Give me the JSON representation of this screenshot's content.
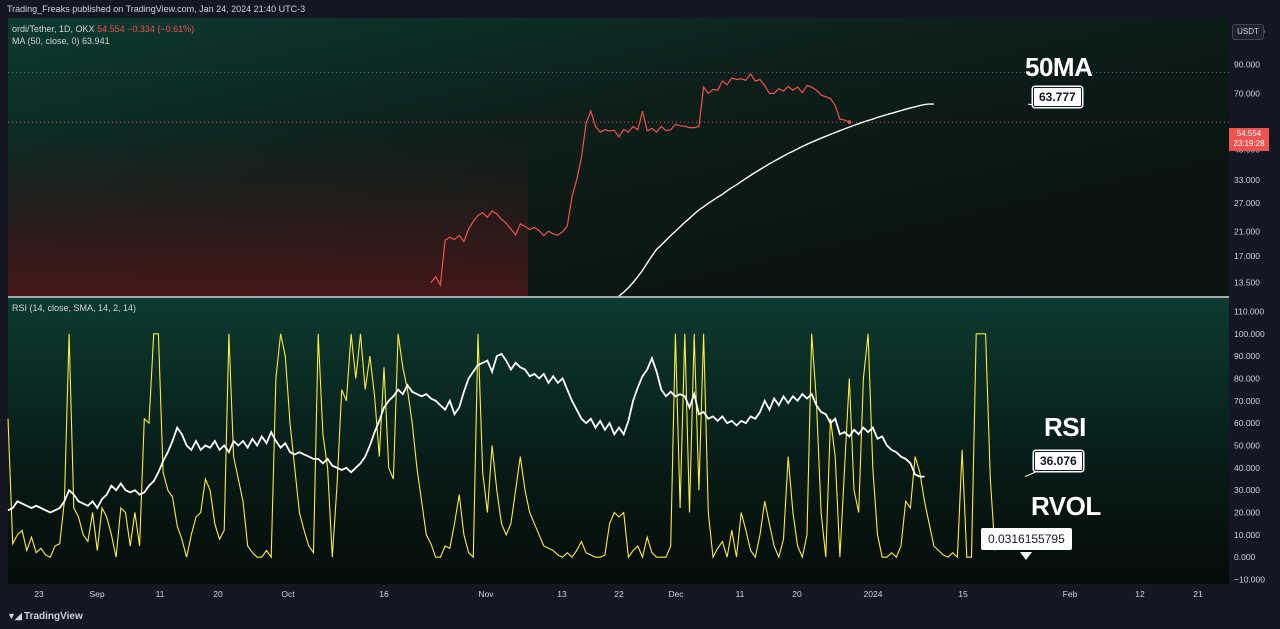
{
  "header": {
    "published": "Trading_Freaks published on TradingView.com, Jan 24, 2024 21:40 UTC-3"
  },
  "legend": {
    "symbol": "ordi/Tether, 1D, OKX",
    "price": "54.554",
    "change": "−0.334 (−0.61%)",
    "ma_label": "MA (50, close, 0)",
    "ma_value": "63.941",
    "rsi_label": "RSI (14, close, SMA, 14, 2, 14)"
  },
  "currency_button": "USDT",
  "price_tag": {
    "price": "54.554",
    "countdown": "23:19:28"
  },
  "annotations": {
    "ma_title": "50MA",
    "ma_callout": "63.777",
    "rsi_title": "RSI",
    "rsi_callout": "36.076",
    "rvol_title": "RVOL",
    "rvol_tooltip": "0.0316155795"
  },
  "footer": {
    "brand": "TradingView"
  },
  "colors": {
    "price": "#ef5350",
    "ma": "#ffffff",
    "rsi": "#ffffff",
    "rvol": "#ffeb3b",
    "background": "#131722"
  },
  "chart_data": [
    {
      "type": "line",
      "pane": "price",
      "scale": "log",
      "x_ticks": [
        "23",
        "Sep",
        "11",
        "20",
        "Oct",
        "16",
        "Nov",
        "13",
        "22",
        "Dec",
        "11",
        "20",
        "2024",
        "15",
        "Feb",
        "12",
        "21"
      ],
      "y_ticks": [
        120,
        90,
        70,
        54.554,
        43,
        33,
        27,
        21,
        17,
        13.5
      ],
      "y_tick_labels": [
        "120.000",
        "90.000",
        "70.000",
        "54.554",
        "43.000",
        "33.000",
        "27.000",
        "21.000",
        "17.000",
        "13.500"
      ],
      "ylim": [
        12.0,
        135
      ],
      "series": [
        {
          "name": "ordi/Tether",
          "start_day": 90,
          "values": [
            13.5,
            14.2,
            13.2,
            19.5,
            20.0,
            19.6,
            20.3,
            19.3,
            21.5,
            23.0,
            24.2,
            24.8,
            23.8,
            25.2,
            24.5,
            23.4,
            22.6,
            21.5,
            20.4,
            22.5,
            22.0,
            21.4,
            21.8,
            21.2,
            20.3,
            21.1,
            20.6,
            20.4,
            21.0,
            22.1,
            28.5,
            33.0,
            40.0,
            54.0,
            60.0,
            52.5,
            50.0,
            51.0,
            50.5,
            50.8,
            48.0,
            51.2,
            50.0,
            52.5,
            51.0,
            60.0,
            50.5,
            51.6,
            50.0,
            52.5,
            50.6,
            51.0,
            53.5,
            52.8,
            52.6,
            52.0,
            52.0,
            52.5,
            74.0,
            70.0,
            72.5,
            72.0,
            78.0,
            75.5,
            80.0,
            79.0,
            79.5,
            78.5,
            83.0,
            78.0,
            79.0,
            75.0,
            70.0,
            70.0,
            73.0,
            71.5,
            74.5,
            72.0,
            74.0,
            70.5,
            75.0,
            74.0,
            72.0,
            69.0,
            68.0,
            67.0,
            63.0,
            56.0,
            55.5,
            54.554
          ]
        },
        {
          "name": "MA (50, close, 0)",
          "start_day": 130,
          "values": [
            12.0,
            12.4,
            12.9,
            13.5,
            14.2,
            15.0,
            16.0,
            17.0,
            18.0,
            18.7,
            19.5,
            20.3,
            21.1,
            21.9,
            22.8,
            23.6,
            24.5,
            25.4,
            26.1,
            26.9,
            27.6,
            28.4,
            29.1,
            30.0,
            30.8,
            31.6,
            32.5,
            33.4,
            34.3,
            35.2,
            36.1,
            37.0,
            37.9,
            38.8,
            39.7,
            40.6,
            41.5,
            42.3,
            43.2,
            44.1,
            45.0,
            45.8,
            46.6,
            47.4,
            48.2,
            49.0,
            49.8,
            50.6,
            51.4,
            52.2,
            53.0,
            53.8,
            54.6,
            55.3,
            56.0,
            56.8,
            57.5,
            58.2,
            58.9,
            59.6,
            60.3,
            61.0,
            61.7,
            62.3,
            63.0,
            63.5,
            63.777,
            63.777
          ]
        }
      ]
    },
    {
      "type": "line",
      "pane": "rsi",
      "y_ticks": [
        110,
        100,
        90,
        80,
        70,
        60,
        50,
        40,
        30,
        20,
        10,
        0,
        -10
      ],
      "y_tick_labels": [
        "110.000",
        "100.000",
        "90.000",
        "80.000",
        "70.000",
        "60.000",
        "50.000",
        "40.000",
        "30.000",
        "20.000",
        "10.000",
        "0.000",
        "−10.000"
      ],
      "ylim": [
        -12,
        116
      ],
      "series": [
        {
          "name": "RSI",
          "start_day": 0,
          "values": [
            21,
            22,
            25,
            24,
            23,
            22,
            23,
            22,
            21,
            20,
            21,
            22,
            25,
            30,
            28,
            25,
            24,
            23,
            25,
            22,
            26,
            28,
            32,
            30,
            33,
            30,
            29,
            30,
            28,
            29,
            32,
            34,
            38,
            43,
            47,
            52,
            58,
            55,
            50,
            48,
            52,
            48,
            50,
            49,
            52,
            48,
            50,
            47,
            52,
            50,
            52,
            49,
            53,
            50,
            54,
            51,
            56,
            52,
            49,
            51,
            47,
            46,
            47,
            46,
            45,
            44,
            44,
            42,
            44,
            41,
            40,
            39,
            40,
            38,
            40,
            42,
            45,
            50,
            56,
            61,
            67,
            70,
            72,
            75,
            73,
            77,
            74,
            73,
            72,
            73,
            71,
            70,
            68,
            66,
            70,
            64,
            67,
            74,
            80,
            83,
            86,
            87,
            88,
            83,
            90,
            91,
            88,
            84,
            87,
            85,
            84,
            81,
            82,
            80,
            82,
            78,
            81,
            78,
            80,
            75,
            70,
            66,
            62,
            60,
            62,
            58,
            61,
            57,
            60,
            55,
            58,
            55,
            61,
            70,
            76,
            81,
            84,
            89,
            83,
            75,
            72,
            74,
            72,
            73,
            72,
            67,
            73,
            64,
            65,
            62,
            63,
            61,
            63,
            60,
            61,
            59,
            61,
            60,
            63,
            62,
            65,
            70,
            66,
            71,
            68,
            72,
            69,
            72,
            70,
            73,
            71,
            73,
            68,
            65,
            64,
            60,
            62,
            55,
            56,
            54,
            57,
            55,
            58,
            56,
            58,
            53,
            54,
            50,
            48,
            47,
            45,
            44,
            42,
            37,
            36.076,
            36.076
          ]
        },
        {
          "name": "RVOL",
          "start_day": 0,
          "values": [
            62,
            6,
            10,
            12,
            3,
            9,
            2,
            4,
            1,
            0,
            5,
            6,
            25,
            100,
            22,
            18,
            10,
            7,
            20,
            3,
            22,
            18,
            10,
            0,
            22,
            20,
            5,
            20,
            5,
            62,
            60,
            100,
            100,
            38,
            30,
            27,
            14,
            8,
            0,
            10,
            18,
            20,
            35,
            30,
            15,
            8,
            12,
            100,
            45,
            35,
            25,
            5,
            2,
            0,
            0,
            3,
            0,
            80,
            100,
            90,
            60,
            40,
            20,
            12,
            5,
            2,
            100,
            55,
            40,
            0,
            32,
            75,
            70,
            100,
            80,
            100,
            75,
            90,
            72,
            45,
            85,
            40,
            35,
            100,
            85,
            75,
            60,
            40,
            25,
            10,
            6,
            0,
            0,
            5,
            4,
            15,
            28,
            10,
            2,
            0,
            100,
            38,
            20,
            50,
            30,
            15,
            10,
            15,
            30,
            45,
            30,
            20,
            15,
            10,
            5,
            4,
            3,
            1,
            0,
            2,
            0,
            3,
            7,
            2,
            1,
            0,
            0,
            1,
            15,
            20,
            18,
            20,
            0,
            3,
            5,
            0,
            9,
            2,
            0,
            0,
            0,
            5,
            100,
            22,
            100,
            20,
            100,
            30,
            100,
            20,
            0,
            4,
            7,
            0,
            12,
            0,
            20,
            12,
            3,
            0,
            10,
            25,
            15,
            5,
            0,
            8,
            45,
            20,
            5,
            0,
            10,
            100,
            70,
            20,
            0,
            62,
            45,
            0,
            40,
            80,
            30,
            20,
            80,
            100,
            40,
            10,
            0,
            0,
            2,
            0,
            5,
            25,
            22,
            45,
            38,
            25,
            15,
            5,
            3,
            1,
            0,
            2,
            0,
            48,
            0,
            0,
            100,
            100,
            100,
            35,
            3
          ]
        }
      ]
    }
  ]
}
